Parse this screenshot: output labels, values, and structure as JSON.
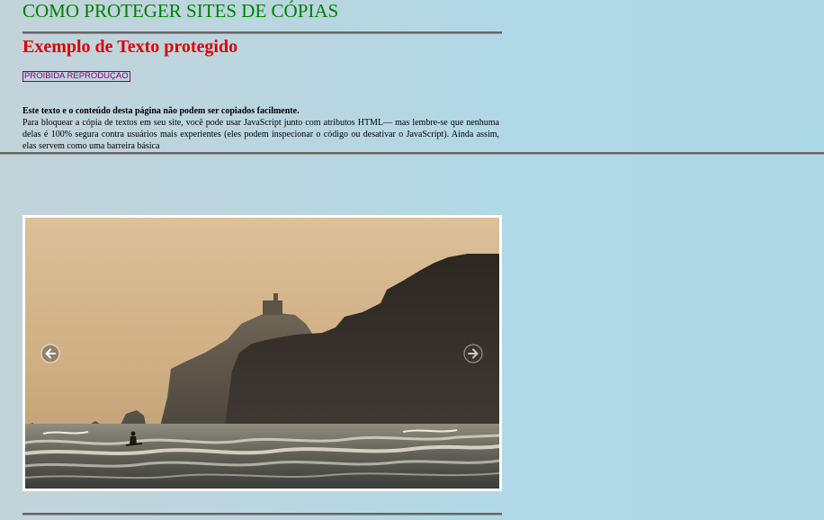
{
  "page": {
    "site_title": "COMO PROTEGER SITES DE CÓPIAS",
    "section_heading": "Exemplo de Texto protegido",
    "badge_label": "PROIBIDA REPRODUÇÃO",
    "lead_text": "Este texto e o conteúdo desta página não podem ser copiados facilmente.",
    "body_text": "Para bloquear a cópia de textos em seu site, você pode usar JavaScript junto com atributos HTML— mas lembre-se que nenhuma delas é 100% segura contra usuários mais experientes (eles podem inspecionar o código ou desativar o JavaScript). Ainda assim, elas servem como uma barreira básica"
  },
  "slider": {
    "image_subject": "surfer on ocean waves with rocky headland and lighthouse at sunset",
    "prev_icon": "arrow-left-circle-icon",
    "next_icon": "arrow-right-circle-icon"
  },
  "colors": {
    "title": "#008000",
    "heading": "#e00000",
    "badge": "#800080",
    "rule": "#666666"
  }
}
